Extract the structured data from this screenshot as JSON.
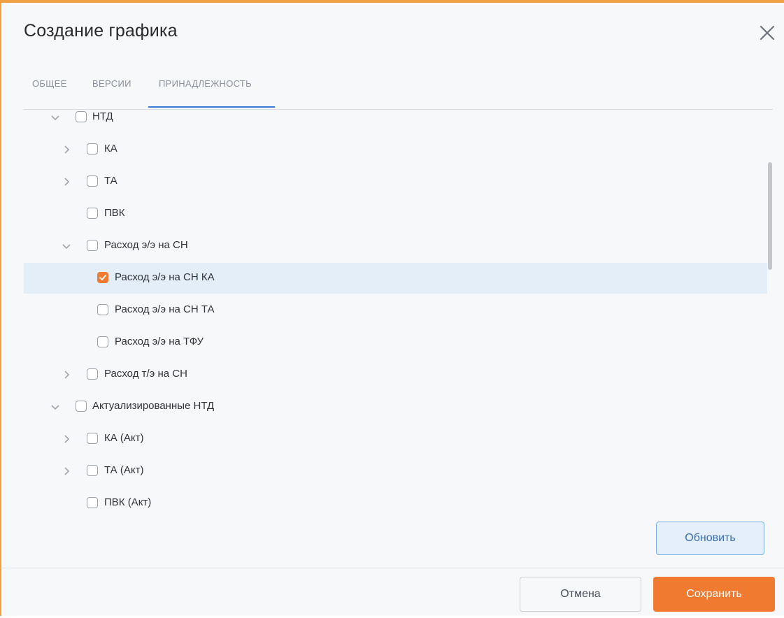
{
  "dialog": {
    "title": "Создание графика"
  },
  "tabs": [
    {
      "label": "ОБЩЕЕ"
    },
    {
      "label": "ВЕРСИИ"
    },
    {
      "label": "ПРИНАДЛЕЖНОСТЬ"
    }
  ],
  "active_tab": "ПРИНАДЛЕЖНОСТЬ",
  "tree": {
    "items": [
      {
        "label": "НТД",
        "expanded": true,
        "checked": false
      },
      {
        "label": "КА",
        "expanded": false,
        "checked": false
      },
      {
        "label": "ТА",
        "expanded": false,
        "checked": false
      },
      {
        "label": "ПВК",
        "checked": false
      },
      {
        "label": "Расход э/э на СН",
        "expanded": true,
        "checked": false
      },
      {
        "label": "Расход э/э на СН КА",
        "checked": true,
        "selected": true
      },
      {
        "label": "Расход э/э на СН ТА",
        "checked": false
      },
      {
        "label": "Расход э/э на ТФУ",
        "checked": false
      },
      {
        "label": "Расход т/э на СН",
        "expanded": false,
        "checked": false
      },
      {
        "label": "Актуализированные НТД",
        "expanded": true,
        "checked": false
      },
      {
        "label": "КА (Акт)",
        "expanded": false,
        "checked": false
      },
      {
        "label": "ТА (Акт)",
        "expanded": false,
        "checked": false
      },
      {
        "label": "ПВК (Акт)",
        "checked": false
      }
    ]
  },
  "buttons": {
    "refresh": "Обновить",
    "cancel": "Отмена",
    "save": "Сохранить"
  },
  "icons": {
    "close": "close-icon",
    "expanded": "chevron-down-icon",
    "collapsed": "chevron-right-icon",
    "checked": "check-icon"
  },
  "colors": {
    "accent": "#f07a30",
    "selection": "#e3eef9",
    "tab_active": "#3a7bd5",
    "window_border": "#f0a040"
  }
}
